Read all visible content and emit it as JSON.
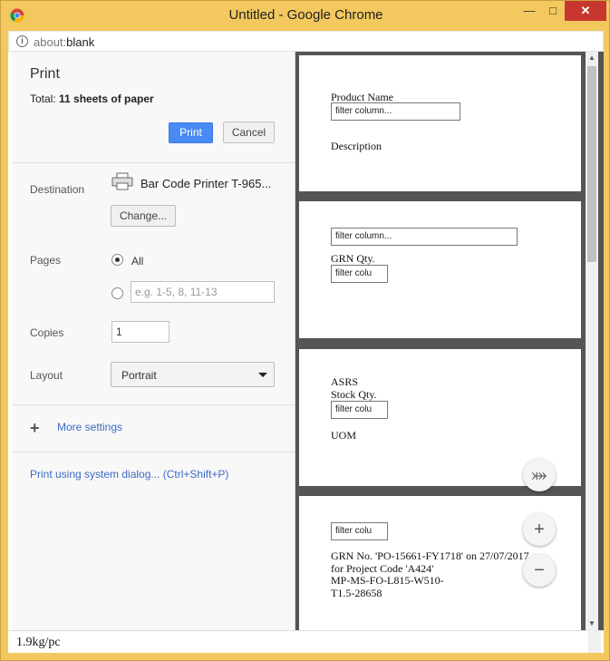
{
  "window": {
    "title": "Untitled - Google Chrome",
    "min_glyph": "—",
    "max_glyph": "□",
    "close_glyph": "✕"
  },
  "address": {
    "prefix": "about:",
    "rest": "blank"
  },
  "print": {
    "title": "Print",
    "total_prefix": "Total: ",
    "total_value": "11 sheets of paper",
    "print_label": "Print",
    "cancel_label": "Cancel",
    "destination_label": "Destination",
    "destination_name": "Bar Code Printer T-965...",
    "change_label": "Change...",
    "pages_label": "Pages",
    "pages_all": "All",
    "pages_placeholder": "e.g. 1-5, 8, 11-13",
    "copies_label": "Copies",
    "copies_value": "1",
    "layout_label": "Layout",
    "layout_value": "Portrait",
    "more_settings": "More settings",
    "system_dialog": "Print using system dialog... (Ctrl+Shift+P)"
  },
  "preview": {
    "page1": {
      "product_name": "Product Name",
      "filter1": "filter column...",
      "description": "Description"
    },
    "page2": {
      "filter_wide": "filter column...",
      "grn_qty": "GRN Qty.",
      "filter_small": "filter colu"
    },
    "page3": {
      "asrs": "ASRS",
      "stock_qty": "Stock Qty.",
      "filter_small": "filter colu",
      "uom": "UOM"
    },
    "page4": {
      "filter_small": "filter colu",
      "grn_line1": "GRN No. 'PO-15661-FY1718'  on 27/07/2017",
      "grn_line2": "for Project Code 'A424'",
      "grn_line3": "MP-MS-FO-L815-W510-",
      "grn_line4": "T1.5-28658"
    },
    "fit_icon": "⤗",
    "zoom_in_icon": "+",
    "zoom_out_icon": "−"
  },
  "bottom": {
    "text": "1.9kg/pc"
  },
  "colors": {
    "frame": "#f3c95f",
    "close_button": "#c7372f",
    "print_button": "#4a8af4",
    "link": "#3b6ac6",
    "preview_bg": "#555555"
  }
}
